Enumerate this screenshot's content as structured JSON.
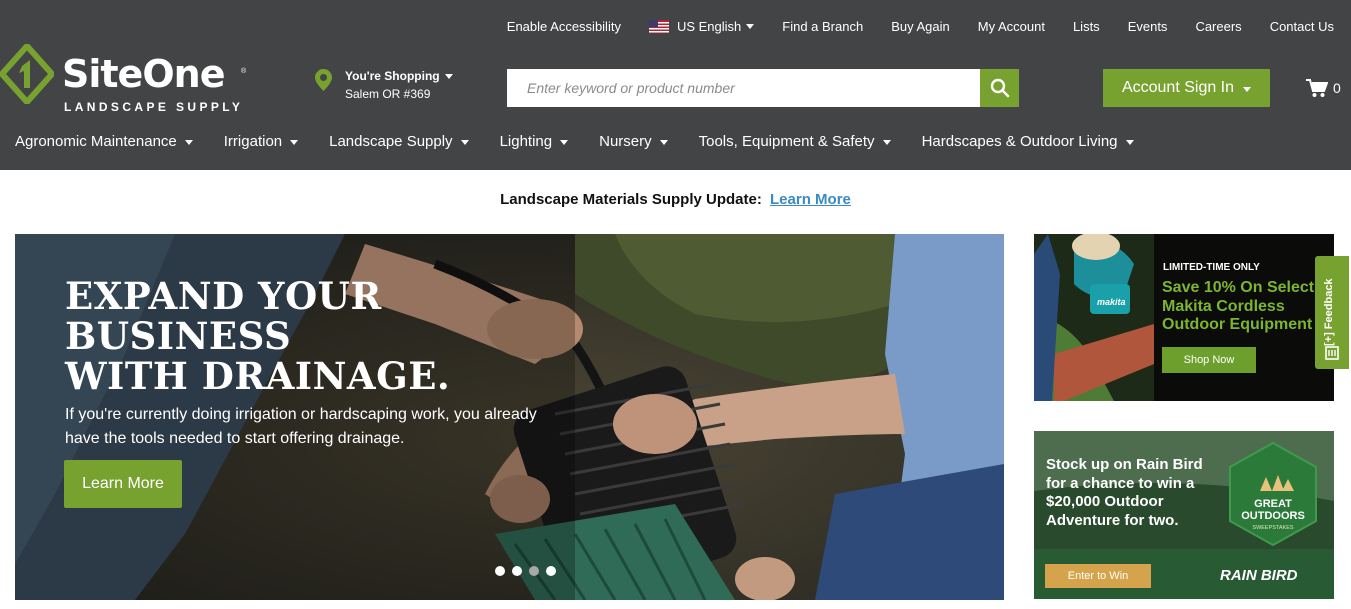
{
  "utility_nav": {
    "accessibility": "Enable Accessibility",
    "language": "US English",
    "find_branch": "Find a Branch",
    "buy_again": "Buy Again",
    "my_account": "My Account",
    "lists": "Lists",
    "events": "Events",
    "careers": "Careers",
    "contact": "Contact Us"
  },
  "logo": {
    "brand": "SiteOne",
    "registered": "®",
    "subtitle": "LANDSCAPE SUPPLY"
  },
  "store": {
    "label": "You're Shopping",
    "location": "Salem OR #369"
  },
  "search": {
    "placeholder": "Enter keyword or product number",
    "icon": "search-icon"
  },
  "account": {
    "sign_in": "Account Sign In"
  },
  "cart": {
    "count": "0",
    "icon": "cart-icon"
  },
  "main_nav": [
    "Agronomic Maintenance",
    "Irrigation",
    "Landscape Supply",
    "Lighting",
    "Nursery",
    "Tools, Equipment & Safety",
    "Hardscapes & Outdoor Living"
  ],
  "notice": {
    "text": "Landscape Materials Supply Update:",
    "link": "Learn More"
  },
  "hero": {
    "headline": [
      "EXPAND YOUR",
      "BUSINESS",
      "WITH DRAINAGE."
    ],
    "body": "If you're currently doing irrigation or hardscaping work, you already have the tools needed to start offering drainage.",
    "cta": "Learn More",
    "slide_count": 4,
    "active_slide": 3
  },
  "promo_makita": {
    "tag": "LIMITED-TIME ONLY",
    "headline": "Save 10% On Select Makita Cordless Outdoor Equipment",
    "cta": "Shop Now",
    "brand": "makita"
  },
  "promo_rainbird": {
    "headline": "Stock up on Rain Bird for a chance to win a $20,000 Outdoor Adventure for two.",
    "badge_line1": "GREAT",
    "badge_line2": "OUTDOORS",
    "badge_line3": "SWEEPSTAKES",
    "cta": "Enter to Win",
    "brand": "RAIN BIRD"
  },
  "feedback": {
    "label": "[+] Feedback"
  },
  "colors": {
    "header_bg": "#434446",
    "accent_green": "#78a22f",
    "link_blue": "#3b8ac4",
    "promo_gold": "#d5a34b"
  }
}
